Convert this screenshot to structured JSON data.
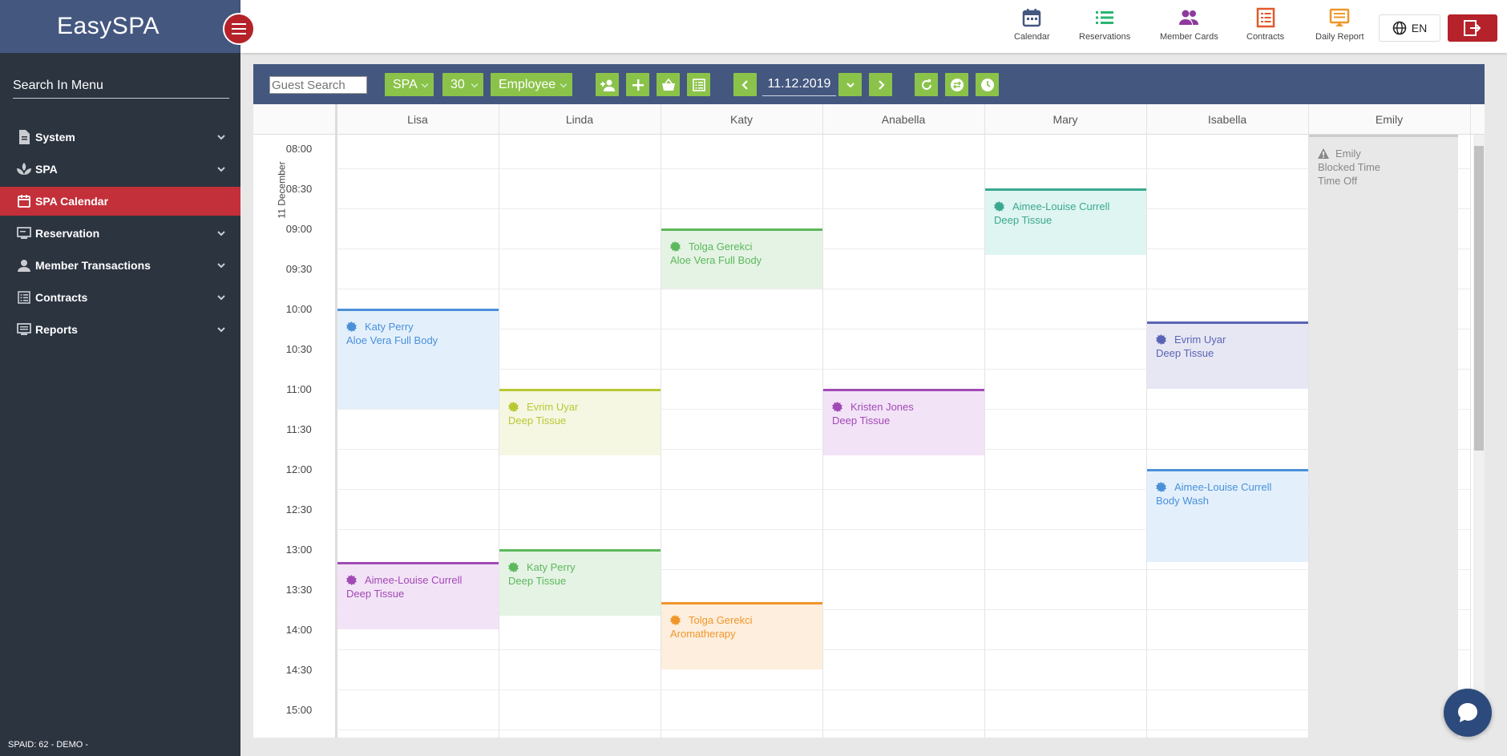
{
  "app": {
    "name": "EasySPA"
  },
  "sidebar": {
    "search_label": "Search In Menu",
    "items": [
      {
        "label": "System",
        "icon": "document-icon",
        "expandable": true
      },
      {
        "label": "SPA",
        "icon": "spa-icon",
        "expandable": true
      },
      {
        "label": "SPA Calendar",
        "icon": "calendar-icon",
        "expandable": false,
        "active": true
      },
      {
        "label": "Reservation",
        "icon": "monitor-icon",
        "expandable": true
      },
      {
        "label": "Member Transactions",
        "icon": "person-icon",
        "expandable": true
      },
      {
        "label": "Contracts",
        "icon": "list-icon",
        "expandable": true
      },
      {
        "label": "Reports",
        "icon": "report-icon",
        "expandable": true
      }
    ],
    "footer": "SPAID: 62 - DEMO -"
  },
  "topnav": {
    "items": [
      {
        "label": "Calendar",
        "icon": "calendar-icon",
        "color": "#44577f"
      },
      {
        "label": "Reservations",
        "icon": "list-icon",
        "color": "#2bb673"
      },
      {
        "label": "Member Cards",
        "icon": "people-icon",
        "color": "#8e3a9d"
      },
      {
        "label": "Contracts",
        "icon": "contract-icon",
        "color": "#e05a2b"
      },
      {
        "label": "Daily Report",
        "icon": "report-icon",
        "color": "#f0962a"
      }
    ],
    "language": "EN"
  },
  "toolbar": {
    "guest_search_placeholder": "Guest Search",
    "category": "SPA",
    "interval": "30",
    "view": "Employee",
    "date": "11.12.2019"
  },
  "calendar": {
    "day_label": "11 December",
    "employees": [
      "Lisa",
      "Linda",
      "Katy",
      "Anabella",
      "Mary",
      "Isabella",
      "Emily"
    ],
    "times": [
      "08:00",
      "08:30",
      "09:00",
      "09:30",
      "10:00",
      "10:30",
      "11:00",
      "11:30",
      "12:00",
      "12:30",
      "13:00",
      "13:30",
      "14:00",
      "14:30",
      "15:00"
    ],
    "appointments": [
      {
        "guest": "Katy Perry",
        "service": "Aloe Vera Full Body",
        "employee": "Lisa",
        "start": "10:00",
        "end": "11:15",
        "color": "#4a90d9",
        "bg": "#e3f0fc"
      },
      {
        "guest": "Aimee-Louise Currell",
        "service": "Deep Tissue",
        "employee": "Lisa",
        "start": "13:10",
        "end": "14:00",
        "color": "#a04ab5",
        "bg": "#f3e3f7"
      },
      {
        "guest": "Evrim Uyar",
        "service": "Deep Tissue",
        "employee": "Linda",
        "start": "11:00",
        "end": "11:50",
        "color": "#b9c832",
        "bg": "#f5f7e3"
      },
      {
        "guest": "Katy Perry",
        "service": "Deep Tissue",
        "employee": "Linda",
        "start": "13:00",
        "end": "13:50",
        "color": "#5cb85c",
        "bg": "#e5f3e5"
      },
      {
        "guest": "Tolga Gerekci",
        "service": "Aloe Vera Full Body",
        "employee": "Katy",
        "start": "09:00",
        "end": "09:45",
        "color": "#5cb85c",
        "bg": "#e5f3e5"
      },
      {
        "guest": "Tolga Gerekci",
        "service": "Aromatherapy",
        "employee": "Katy",
        "start": "13:40",
        "end": "14:30",
        "color": "#f0962a",
        "bg": "#fdeedd"
      },
      {
        "guest": "Kristen Jones",
        "service": "Deep Tissue",
        "employee": "Anabella",
        "start": "11:00",
        "end": "11:50",
        "color": "#a04ab5",
        "bg": "#f3e3f7"
      },
      {
        "guest": "Aimee-Louise Currell",
        "service": "Deep Tissue",
        "employee": "Mary",
        "start": "08:30",
        "end": "09:20",
        "color": "#3aa890",
        "bg": "#dff5f1"
      },
      {
        "guest": "Evrim Uyar",
        "service": "Deep Tissue",
        "employee": "Isabella",
        "start": "10:10",
        "end": "11:00",
        "color": "#5a64b5",
        "bg": "#e6e7f3"
      },
      {
        "guest": "Aimee-Louise Currell",
        "service": "Body Wash",
        "employee": "Isabella",
        "start": "12:00",
        "end": "13:10",
        "color": "#4a90d9",
        "bg": "#e3f0fc"
      }
    ],
    "blocked": {
      "employee": "Emily",
      "lines": [
        "Emily",
        "Blocked Time",
        "Time Off"
      ]
    }
  }
}
